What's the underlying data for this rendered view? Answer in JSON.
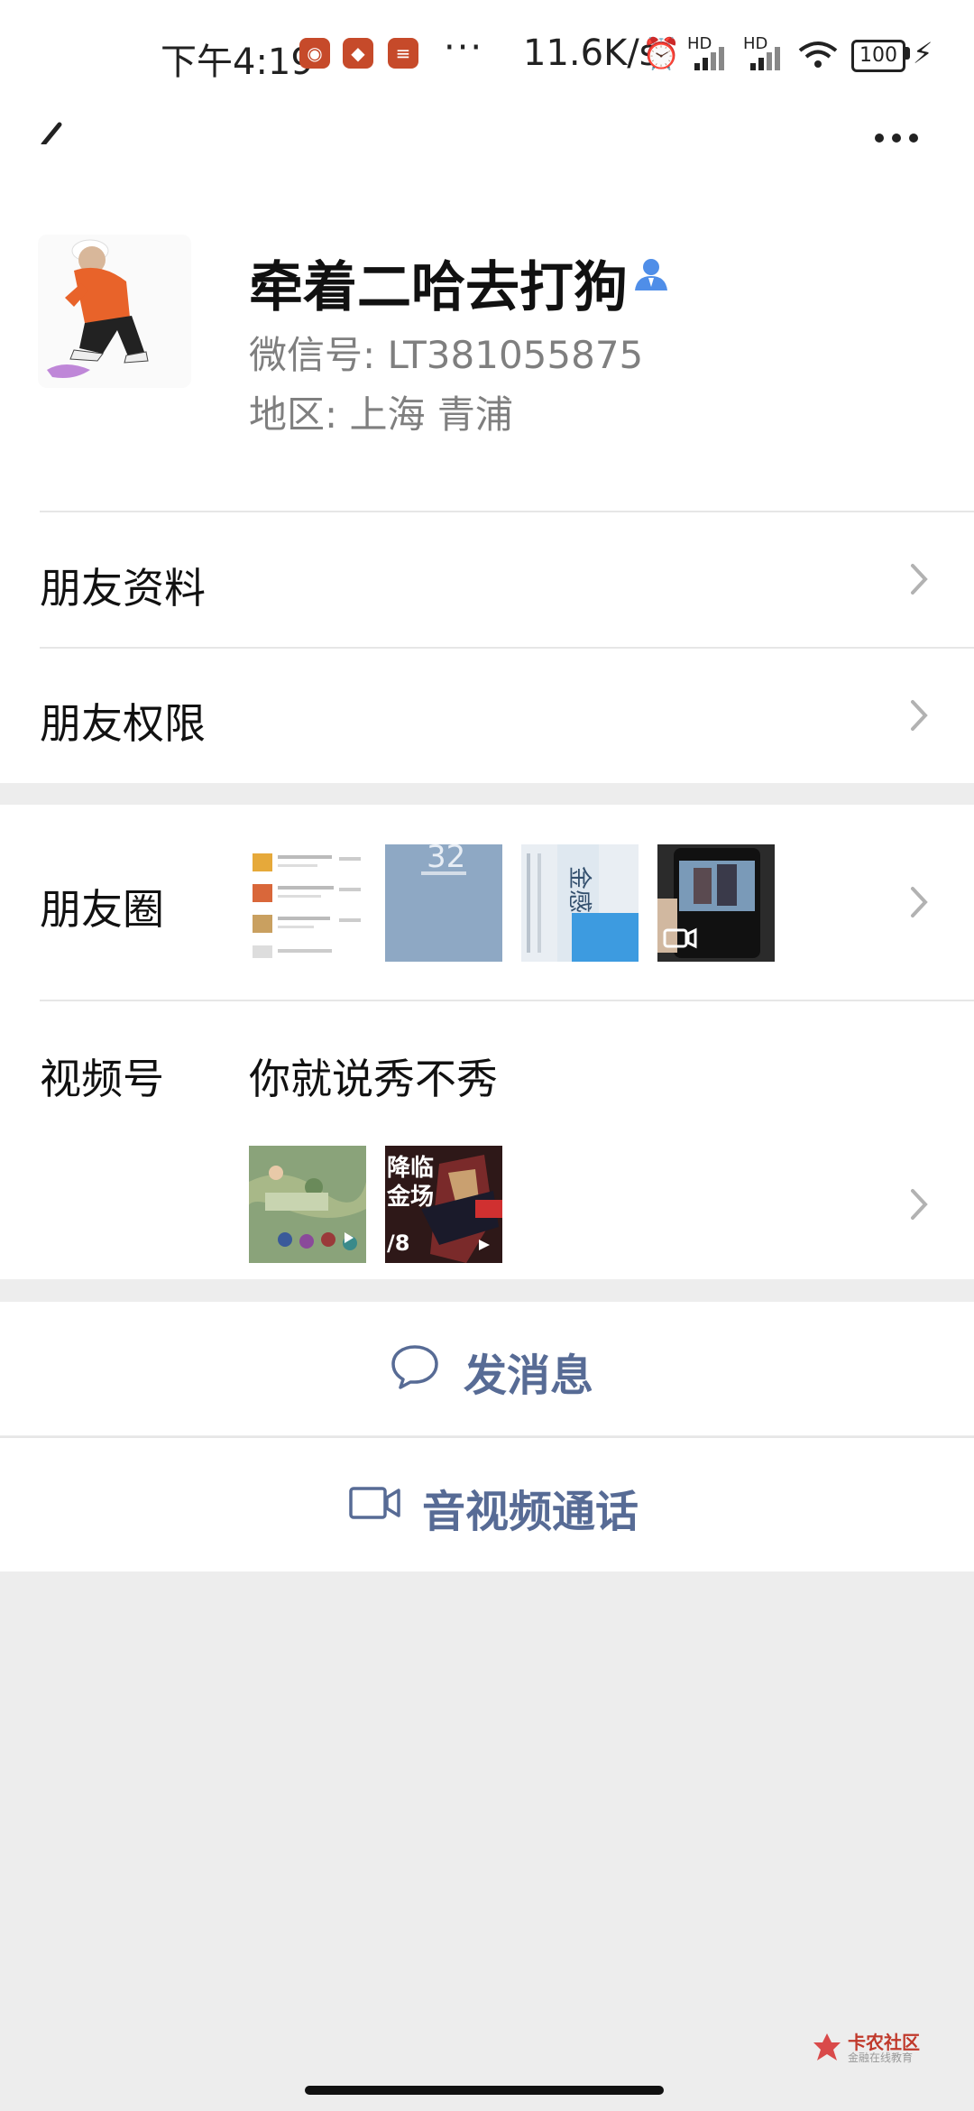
{
  "status_bar": {
    "time": "下午4:19",
    "dots": "···",
    "speed": "11.6K/s",
    "battery": "100",
    "signal1": "HD",
    "signal2": "HD"
  },
  "profile": {
    "name": "牵着二哈去打狗",
    "wechat_id": "微信号: LT381055875",
    "region": "地区: 上海  青浦"
  },
  "rows": {
    "friend_info": "朋友资料",
    "friend_permissions": "朋友权限",
    "moments": "朋友圈",
    "channels": "视频号",
    "channels_title": "你就说秀不秀"
  },
  "actions": {
    "send_message": "发消息",
    "av_call": "音视频通话"
  },
  "thumb_text": {
    "moments_2": "32",
    "channels_2a": "降临",
    "channels_2b": "金场",
    "channels_2c": "/8"
  },
  "watermark": {
    "title": "卡农社区",
    "subtitle": "金融在线教育"
  },
  "colors": {
    "link": "#576b95",
    "background": "#ededed"
  }
}
